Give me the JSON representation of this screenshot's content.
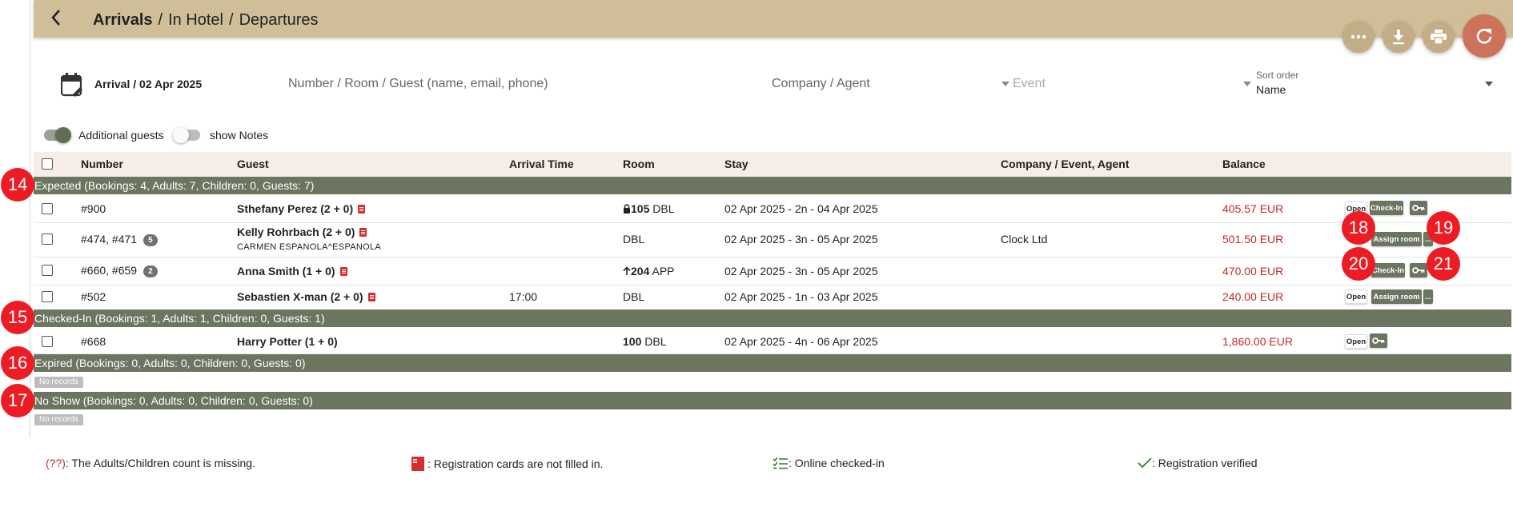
{
  "breadcrumb": {
    "current": "Arrivals",
    "sep1": "/",
    "item2": "In Hotel",
    "sep2": "/",
    "item3": "Departures"
  },
  "actions": {
    "more": "more-icon",
    "download": "download-icon",
    "print": "print-icon",
    "refresh": "refresh-icon"
  },
  "filters": {
    "date_label": "Arrival / 02 Apr 2025",
    "search_placeholder": "Number / Room / Guest (name, email, phone)",
    "company_placeholder": "Company / Agent",
    "event_placeholder": "Event",
    "sort_label": "Sort order",
    "sort_value": "Name"
  },
  "toggles": {
    "additional_guests": "Additional guests",
    "show_notes": "show Notes",
    "additional_guests_on": true,
    "show_notes_on": false
  },
  "columns": {
    "number": "Number",
    "guest": "Guest",
    "arrival": "Arrival Time",
    "room": "Room",
    "stay": "Stay",
    "company": "Company / Event, Agent",
    "balance": "Balance"
  },
  "groups": {
    "expected": "Expected (Bookings: 4, Adults: 7, Children: 0, Guests: 7)",
    "checked_in": "Checked-In (Bookings: 1, Adults: 1, Children: 0, Guests: 1)",
    "expired": "Expired (Bookings: 0, Adults: 0, Children: 0, Guests: 0)",
    "no_show": "No Show (Bookings: 0, Adults: 0, Children: 0, Guests: 0)"
  },
  "no_records": "No records",
  "rows": [
    {
      "number": "#900",
      "guest": "Sthefany Perez (2 + 0)",
      "arrival": "",
      "room_num": "105",
      "room_type": "DBL",
      "stay": "02 Apr 2025 - 2n - 04 Apr 2025",
      "company": "",
      "balance": "405.57 EUR",
      "btn_open": "Open",
      "btn_checkin": "Check-In"
    },
    {
      "number": "#474, #471",
      "badge": "5",
      "guest": "Kelly Rohrbach (2 + 0)",
      "guest_sub": "CARMEN ESPANOLA^ESPANOLA",
      "arrival": "",
      "room_type": "DBL",
      "stay": "02 Apr 2025 - 3n - 05 Apr 2025",
      "company": "Clock Ltd",
      "balance": "501.50 EUR",
      "btn_assign": "Assign room",
      "btn_more": "..."
    },
    {
      "number": "#660, #659",
      "badge": "2",
      "guest": "Anna Smith (1 + 0)",
      "arrival": "",
      "room_num": "204",
      "room_type": "APP",
      "stay": "02 Apr 2025 - 3n - 05 Apr 2025",
      "company": "",
      "balance": "470.00 EUR",
      "btn_checkin": "Check-In"
    },
    {
      "number": "#502",
      "guest": "Sebastien X-man (2 + 0)",
      "arrival": "17:00",
      "room_type": "DBL",
      "stay": "02 Apr 2025 - 1n - 03 Apr 2025",
      "company": "",
      "balance": "240.00 EUR",
      "btn_open": "Open",
      "btn_assign": "Assign room",
      "btn_more": "..."
    },
    {
      "number": "#668",
      "guest": "Harry Potter (1 + 0)",
      "arrival": "",
      "room_num": "100",
      "room_type": "DBL",
      "stay": "02 Apr 2025 - 4n - 06 Apr 2025",
      "company": "",
      "balance": "1,860.00 EUR",
      "btn_open": "Open"
    }
  ],
  "markers": {
    "m14": "14",
    "m15": "15",
    "m16": "16",
    "m17": "17",
    "m18": "18",
    "m19": "19",
    "m20": "20",
    "m21": "21"
  },
  "legend": {
    "missing_mark": "(??)",
    "missing_text": ": The Adults/Children count is missing.",
    "reg_text": ": Registration cards are not filled in.",
    "online_text": ": Online checked-in",
    "verified_text": ": Registration verified"
  },
  "colors": {
    "header_bg": "#cfbe98",
    "group_bg": "#6b7560",
    "balance": "#c62828",
    "marker": "#ed1c24"
  }
}
